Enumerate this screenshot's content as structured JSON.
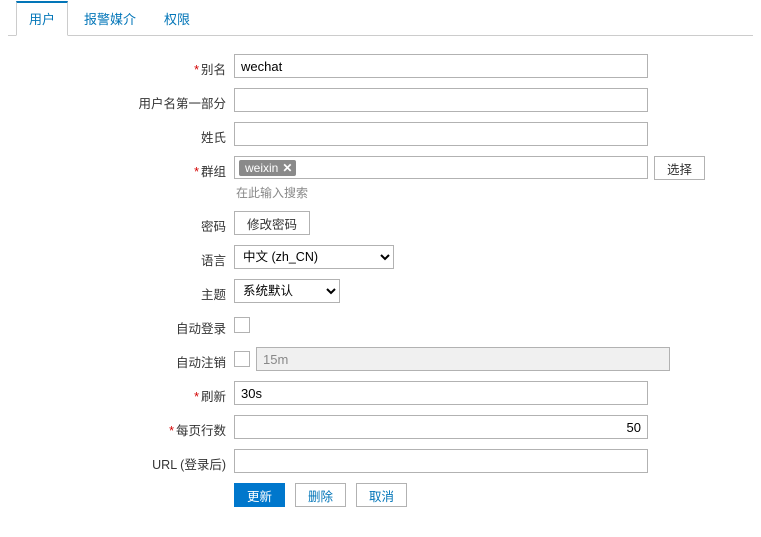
{
  "tabs": {
    "user": "用户",
    "media": "报警媒介",
    "perm": "权限"
  },
  "labels": {
    "alias": "别名",
    "firstname": "用户名第一部分",
    "lastname": "姓氏",
    "groups": "群组",
    "groups_hint": "在此输入搜索",
    "password": "密码",
    "language": "语言",
    "theme": "主题",
    "autologin": "自动登录",
    "autologout": "自动注销",
    "refresh": "刷新",
    "rows": "每页行数",
    "url": "URL (登录后)"
  },
  "values": {
    "alias": "wechat",
    "firstname": "",
    "lastname": "",
    "group_tag": "weixin",
    "autologout": "15m",
    "refresh": "30s",
    "rows": "50",
    "url": "",
    "language_selected": "中文 (zh_CN)",
    "theme_selected": "系统默认"
  },
  "buttons": {
    "select": "选择",
    "change_pwd": "修改密码",
    "update": "更新",
    "delete": "删除",
    "cancel": "取消"
  }
}
